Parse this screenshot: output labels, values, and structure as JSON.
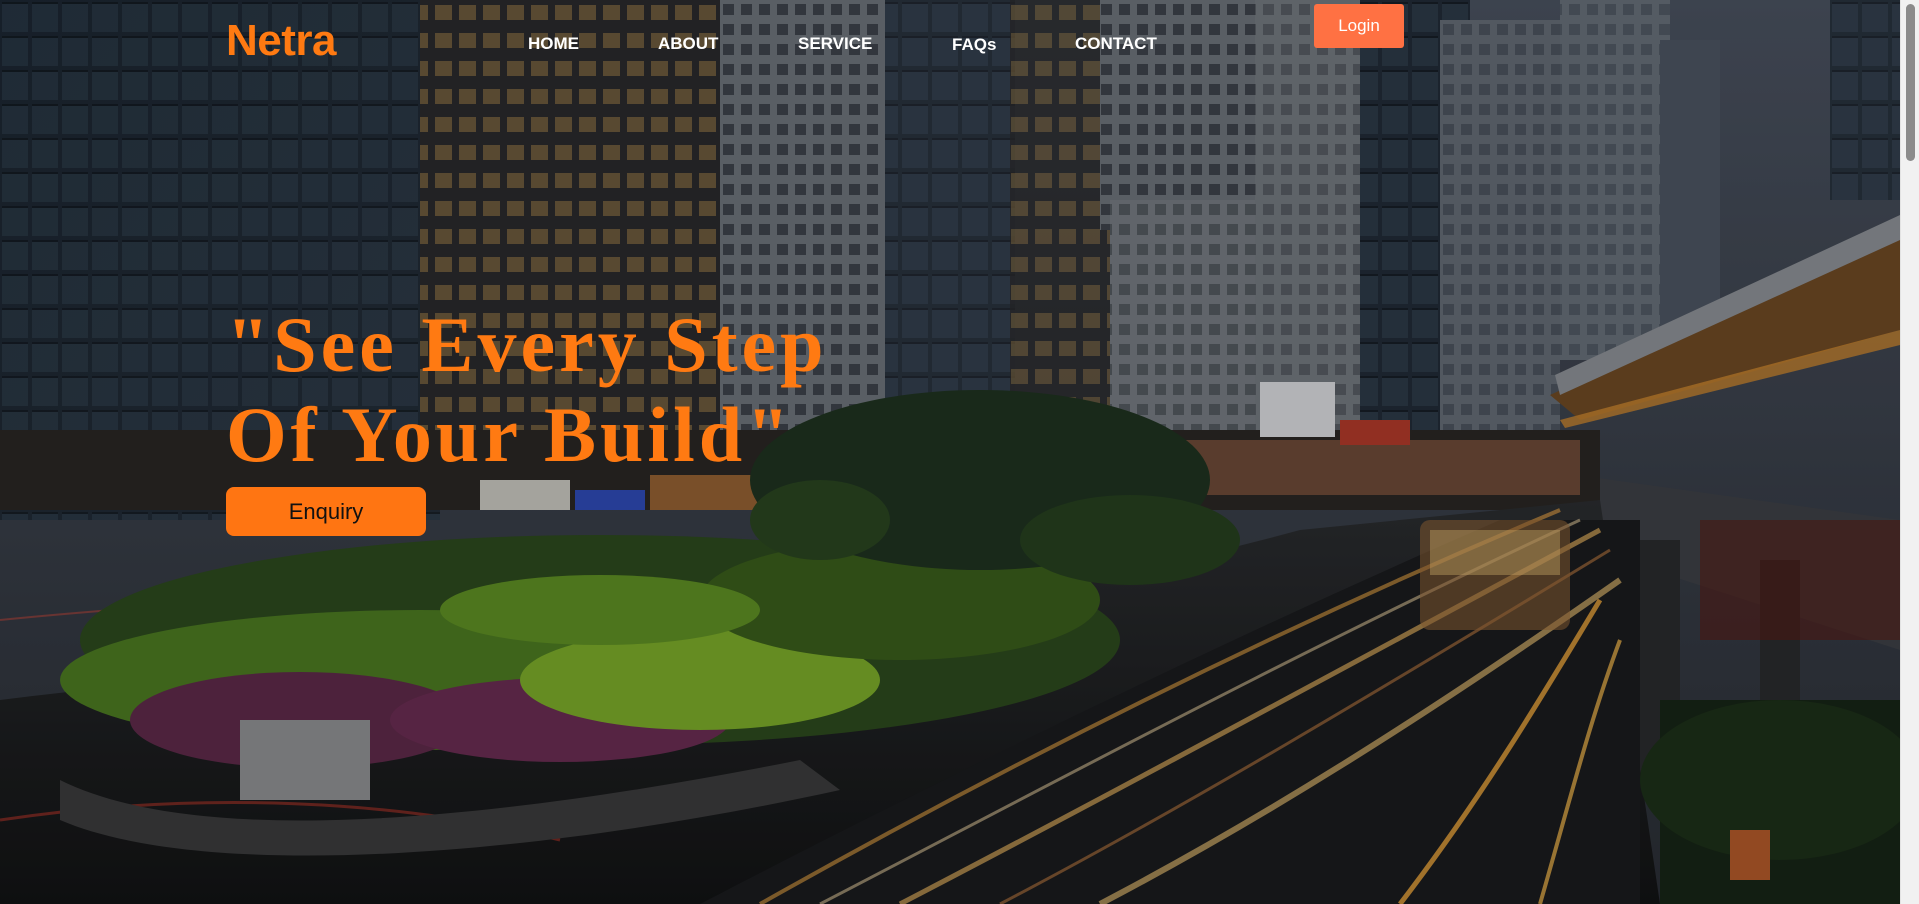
{
  "brand": {
    "logo_text": "Netra",
    "accent_color": "#ff7a12"
  },
  "nav": {
    "items": [
      {
        "label": "HOME"
      },
      {
        "label": "ABOUT"
      },
      {
        "label": "SERVICE"
      },
      {
        "label": "FAQs"
      },
      {
        "label": "CONTACT"
      }
    ],
    "login_label": "Login",
    "login_color": "#ff7143"
  },
  "hero": {
    "title_line1": "\"See Every Step",
    "title_line2": "Of Your Build\"",
    "cta_label": "Enquiry",
    "background_description_icon": "city-street-photo"
  }
}
